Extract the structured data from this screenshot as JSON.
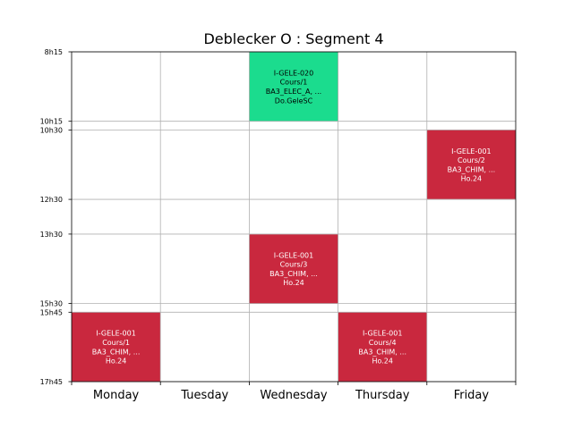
{
  "chart_data": {
    "type": "table",
    "title": "Deblecker O : Segment 4",
    "days": [
      "Monday",
      "Tuesday",
      "Wednesday",
      "Thursday",
      "Friday"
    ],
    "ytick_labels": [
      "8h15",
      "10h15",
      "10h30",
      "12h30",
      "13h30",
      "15h30",
      "15h45",
      "17h45"
    ],
    "ytick_minutes": [
      495,
      615,
      630,
      750,
      810,
      930,
      945,
      1065
    ],
    "ylim": [
      495,
      1065
    ],
    "grid": true,
    "colors": {
      "event_green": "#1bdc8e",
      "event_red": "#c9283e",
      "grid": "#b0b0b0",
      "axis": "#000000"
    },
    "events": [
      {
        "day": 2,
        "start": 495,
        "end": 615,
        "color": "#1bdc8e",
        "text_color": "#000000",
        "lines": [
          "I-GELE-020",
          "Cours/1",
          "BA3_ELEC_A, ...",
          "Do.GeleSC"
        ]
      },
      {
        "day": 4,
        "start": 630,
        "end": 750,
        "color": "#c9283e",
        "text_color": "#ffffff",
        "lines": [
          "I-GELE-001",
          "Cours/2",
          "BA3_CHIM, ...",
          "Ho.24"
        ]
      },
      {
        "day": 2,
        "start": 810,
        "end": 930,
        "color": "#c9283e",
        "text_color": "#ffffff",
        "lines": [
          "I-GELE-001",
          "Cours/3",
          "BA3_CHIM, ...",
          "Ho.24"
        ]
      },
      {
        "day": 0,
        "start": 945,
        "end": 1065,
        "color": "#c9283e",
        "text_color": "#ffffff",
        "lines": [
          "I-GELE-001",
          "Cours/1",
          "BA3_CHIM, ...",
          "Ho.24"
        ]
      },
      {
        "day": 3,
        "start": 945,
        "end": 1065,
        "color": "#c9283e",
        "text_color": "#ffffff",
        "lines": [
          "I-GELE-001",
          "Cours/4",
          "BA3_CHIM, ...",
          "Ho.24"
        ]
      }
    ]
  }
}
